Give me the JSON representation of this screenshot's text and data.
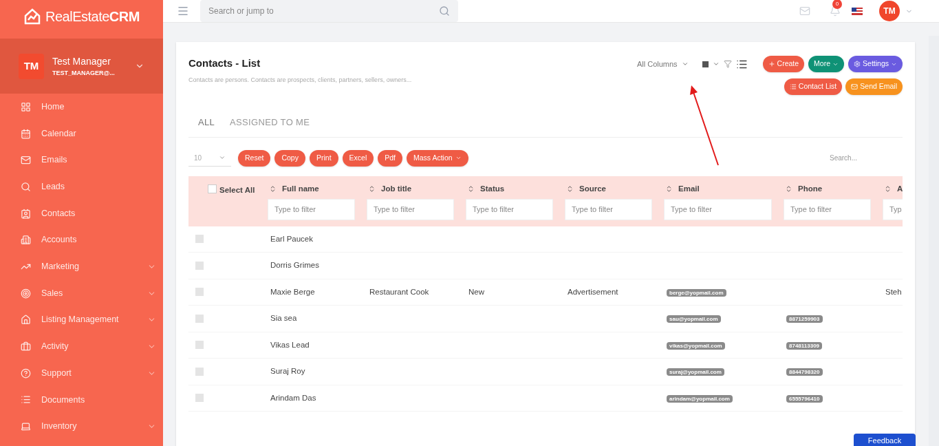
{
  "brand": {
    "name_light": "RealEstate",
    "name_bold": "CRM"
  },
  "user": {
    "initials": "TM",
    "name": "Test Manager",
    "email": "TEST_MANAGER@..."
  },
  "sidebar": {
    "items": [
      {
        "label": "Home",
        "expandable": false
      },
      {
        "label": "Calendar",
        "expandable": false
      },
      {
        "label": "Emails",
        "expandable": false
      },
      {
        "label": "Leads",
        "expandable": false
      },
      {
        "label": "Contacts",
        "expandable": false
      },
      {
        "label": "Accounts",
        "expandable": false
      },
      {
        "label": "Marketing",
        "expandable": true
      },
      {
        "label": "Sales",
        "expandable": true
      },
      {
        "label": "Listing Management",
        "expandable": true
      },
      {
        "label": "Activity",
        "expandable": true
      },
      {
        "label": "Support",
        "expandable": true
      },
      {
        "label": "Documents",
        "expandable": false
      },
      {
        "label": "Inventory",
        "expandable": true
      }
    ]
  },
  "topbar": {
    "search_placeholder": "Search or jump to",
    "notification_count": "0",
    "avatar": "TM"
  },
  "page": {
    "title": "Contacts - List",
    "subtitle": "Contacts are persons. Contacts are prospects, clients, partners, sellers, owners...",
    "columns_select": "All Columns",
    "actions": [
      {
        "label": "Create",
        "color": "#ef5b45",
        "caret": false
      },
      {
        "label": "More",
        "color": "#0f9276",
        "caret": true
      },
      {
        "label": "Settings",
        "color": "#6a5be0",
        "caret": true
      }
    ],
    "actions2": [
      {
        "label": "Contact List",
        "color": "#ef5b45"
      },
      {
        "label": "Send Email",
        "color": "#f7921e"
      }
    ]
  },
  "tabs": [
    {
      "label": "ALL",
      "selected": true
    },
    {
      "label": "ASSIGNED TO ME",
      "selected": false
    }
  ],
  "toolbar": {
    "page_size": "10",
    "buttons": [
      {
        "label": "Reset",
        "caret": false
      },
      {
        "label": "Copy",
        "caret": false
      },
      {
        "label": "Print",
        "caret": false
      },
      {
        "label": "Excel",
        "caret": false
      },
      {
        "label": "Pdf",
        "caret": false
      },
      {
        "label": "Mass Action",
        "caret": true
      }
    ],
    "search_placeholder": "Search..."
  },
  "table": {
    "select_all": "Select All",
    "select_all_checked": false,
    "columns": [
      {
        "label": "Full name",
        "placeholder": "Type to filter"
      },
      {
        "label": "Job title",
        "placeholder": "Type to filter"
      },
      {
        "label": "Status",
        "placeholder": "Type to filter"
      },
      {
        "label": "Source",
        "placeholder": "Type to filter"
      },
      {
        "label": "Email",
        "placeholder": "Type to filter"
      },
      {
        "label": "Phone",
        "placeholder": "Type to filter"
      },
      {
        "label": "A",
        "placeholder": "Typ"
      }
    ],
    "rows": [
      {
        "checked": false,
        "cells": [
          "Earl Paucek",
          "",
          "",
          "",
          "",
          "",
          ""
        ]
      },
      {
        "checked": false,
        "cells": [
          "Dorris Grimes",
          "",
          "",
          "",
          "",
          "",
          ""
        ]
      },
      {
        "checked": false,
        "cells": [
          "Maxie Berge",
          "Restaurant Cook",
          "New",
          "Advertisement",
          "berge@yopmail.com",
          "",
          "Steh"
        ]
      },
      {
        "checked": false,
        "cells": [
          "Sia sea",
          "",
          "",
          "",
          "sau@yopmail.com",
          "8871259903",
          ""
        ]
      },
      {
        "checked": false,
        "cells": [
          "Vikas Lead",
          "",
          "",
          "",
          "vikas@yopmail.com",
          "8748113309",
          ""
        ]
      },
      {
        "checked": false,
        "cells": [
          "Suraj Roy",
          "",
          "",
          "",
          "suraj@yopmail.com",
          "8844798320",
          ""
        ]
      },
      {
        "checked": false,
        "cells": [
          "Arindam Das",
          "",
          "",
          "",
          "arindam@yopmail.com",
          "6555796410",
          ""
        ]
      }
    ]
  },
  "feedback": "Feedback"
}
